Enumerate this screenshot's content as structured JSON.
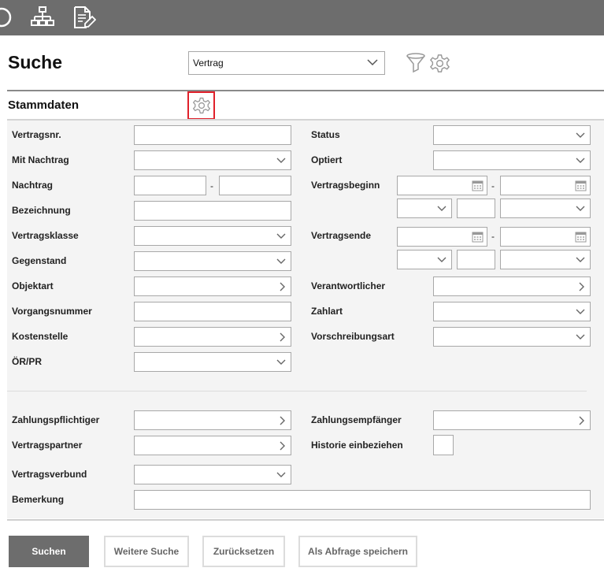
{
  "toolbar": {
    "icons": [
      "help-icon",
      "org-tree-icon",
      "edit-document-icon"
    ]
  },
  "header": {
    "title": "Suche",
    "search_type": {
      "selected": "Vertrag"
    },
    "icons": [
      "filter-icon",
      "gear-icon"
    ]
  },
  "section": {
    "title": "Stammdaten",
    "settings_icon": "gear-icon"
  },
  "left_fields": {
    "vertragsnr": "Vertragsnr.",
    "mit_nachtrag": "Mit Nachtrag",
    "nachtrag": "Nachtrag",
    "bezeichnung": "Bezeichnung",
    "vertragsklasse": "Vertragsklasse",
    "gegenstand": "Gegenstand",
    "objektart": "Objektart",
    "vorgangsnummer": "Vorgangsnummer",
    "kostenstelle": "Kostenstelle",
    "oer_pr": "ÖR/PR"
  },
  "right_fields": {
    "status": "Status",
    "optiert": "Optiert",
    "vertragsbeginn": "Vertragsbeginn",
    "vertragsende": "Vertragsende",
    "verantwortlicher": "Verantwortlicher",
    "zahlart": "Zahlart",
    "vorschreibungsart": "Vorschreibungsart"
  },
  "range_separator": "-",
  "party_fields": {
    "zahlungspflichtiger": "Zahlungspflichtiger",
    "zahlungsempfaenger": "Zahlungsempfänger",
    "vertragspartner": "Vertragspartner",
    "historie": "Historie einbeziehen",
    "vertragsverbund": "Vertragsverbund",
    "bemerkung": "Bemerkung"
  },
  "buttons": {
    "search": "Suchen",
    "more_search": "Weitere Suche",
    "reset": "Zurücksetzen",
    "save_query": "Als Abfrage speichern"
  },
  "colors": {
    "toolbar_bg": "#6d6d6d",
    "panel_bg": "#f4f4f4",
    "highlight_border": "#e0202a"
  }
}
